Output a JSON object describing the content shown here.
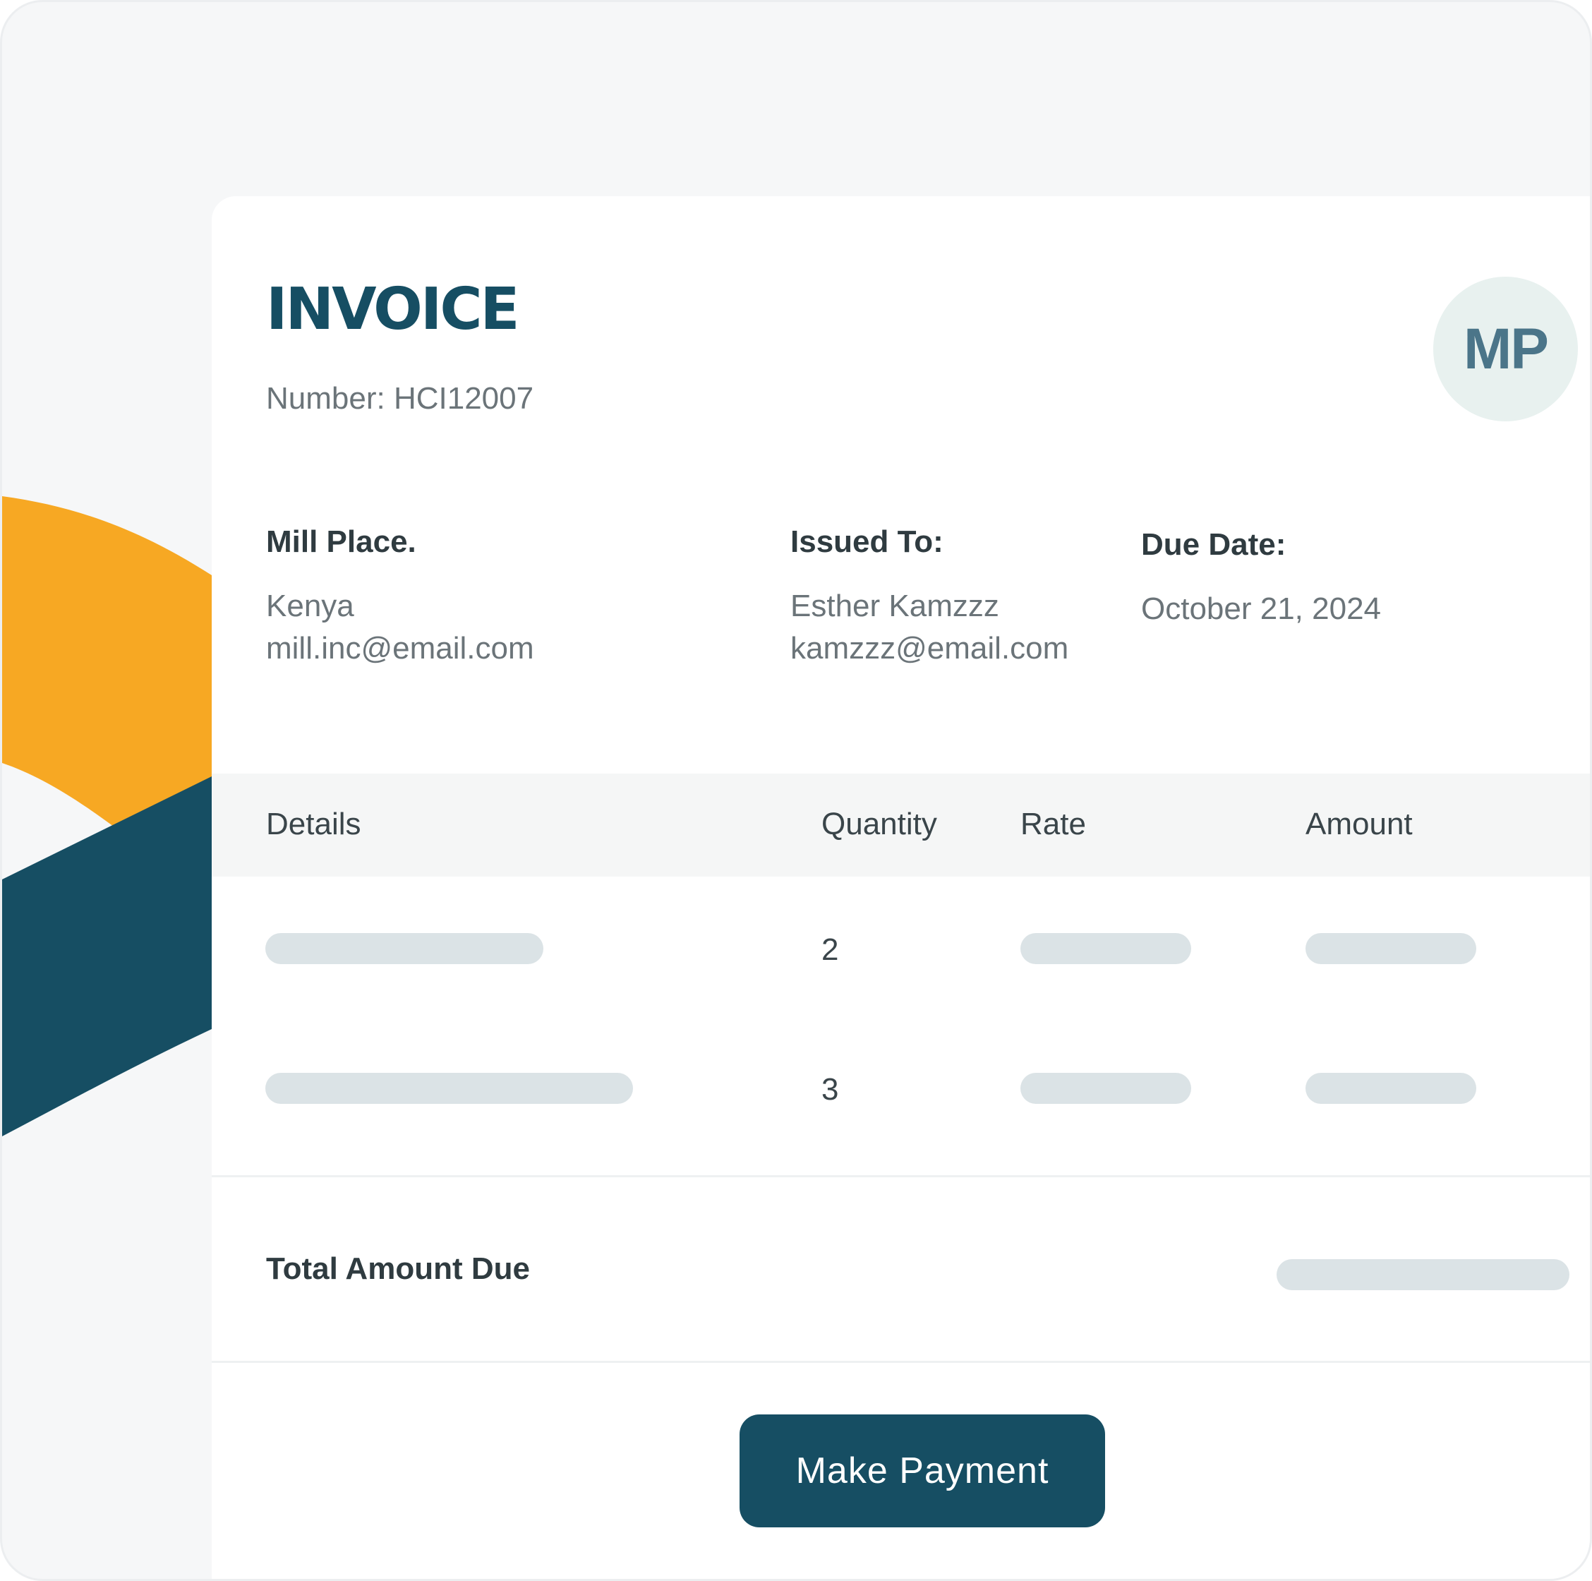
{
  "invoice": {
    "title": "INVOICE",
    "number_text": "Number: HCI12007",
    "avatar_initials": "MP"
  },
  "from": {
    "name": "Mill Place.",
    "country": "Kenya",
    "email": "mill.inc@email.com"
  },
  "issued_to": {
    "label": "Issued To:",
    "name": "Esther Kamzzz",
    "email": "kamzzz@email.com"
  },
  "due": {
    "label": "Due Date:",
    "date": "October 21, 2024"
  },
  "table": {
    "headers": [
      "Details",
      "Quantity",
      "Rate",
      "Amount"
    ],
    "rows": [
      {
        "quantity": "2"
      },
      {
        "quantity": "3"
      }
    ]
  },
  "total": {
    "label": "Total Amount Due"
  },
  "actions": {
    "pay_label": "Make Payment"
  },
  "colors": {
    "brand_teal": "#164e63",
    "accent_orange": "#f7a823",
    "skeleton": "#dbe3e6"
  }
}
